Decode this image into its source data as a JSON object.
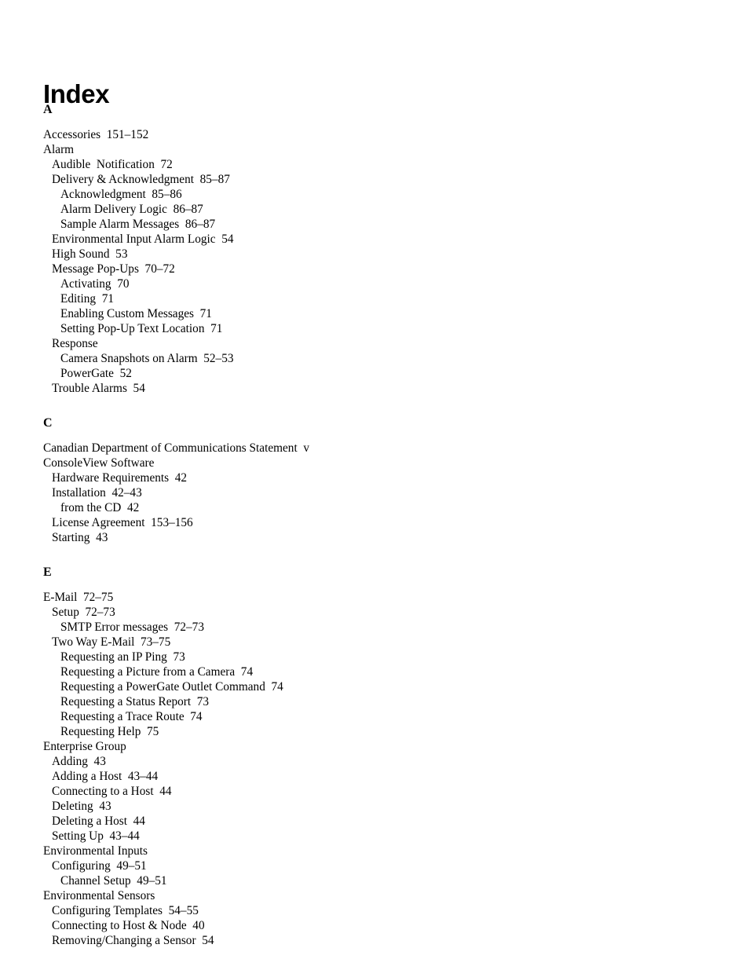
{
  "document": {
    "title": "Index"
  },
  "sections": [
    {
      "letter": "A",
      "entries": [
        {
          "level": 0,
          "text": "Accessories  151–152"
        },
        {
          "level": 0,
          "text": "Alarm"
        },
        {
          "level": 1,
          "text": "Audible  Notification  72"
        },
        {
          "level": 1,
          "text": "Delivery & Acknowledgment  85–87"
        },
        {
          "level": 2,
          "text": "Acknowledgment  85–86"
        },
        {
          "level": 2,
          "text": "Alarm Delivery Logic  86–87"
        },
        {
          "level": 2,
          "text": "Sample Alarm Messages  86–87"
        },
        {
          "level": 1,
          "text": "Environmental Input Alarm Logic  54"
        },
        {
          "level": 1,
          "text": "High Sound  53"
        },
        {
          "level": 1,
          "text": "Message Pop-Ups  70–72"
        },
        {
          "level": 2,
          "text": "Activating  70"
        },
        {
          "level": 2,
          "text": "Editing  71"
        },
        {
          "level": 2,
          "text": "Enabling Custom Messages  71"
        },
        {
          "level": 2,
          "text": "Setting Pop-Up Text Location  71"
        },
        {
          "level": 1,
          "text": "Response"
        },
        {
          "level": 2,
          "text": "Camera Snapshots on Alarm  52–53"
        },
        {
          "level": 2,
          "text": "PowerGate  52"
        },
        {
          "level": 1,
          "text": "Trouble Alarms  54"
        }
      ]
    },
    {
      "letter": "C",
      "entries": [
        {
          "level": 0,
          "text": "Canadian Department of Communications Statement  v"
        },
        {
          "level": 0,
          "text": "ConsoleView Software"
        },
        {
          "level": 1,
          "text": "Hardware Requirements  42"
        },
        {
          "level": 1,
          "text": "Installation  42–43"
        },
        {
          "level": 2,
          "text": "from the CD  42"
        },
        {
          "level": 1,
          "text": "License Agreement  153–156"
        },
        {
          "level": 1,
          "text": "Starting  43"
        }
      ]
    },
    {
      "letter": "E",
      "entries": [
        {
          "level": 0,
          "text": "E-Mail  72–75"
        },
        {
          "level": 1,
          "text": "Setup  72–73"
        },
        {
          "level": 2,
          "text": "SMTP Error messages  72–73"
        },
        {
          "level": 1,
          "text": "Two Way E-Mail  73–75"
        },
        {
          "level": 2,
          "text": "Requesting an IP Ping  73"
        },
        {
          "level": 2,
          "text": "Requesting a Picture from a Camera  74"
        },
        {
          "level": 2,
          "text": "Requesting a PowerGate Outlet Command  74"
        },
        {
          "level": 2,
          "text": "Requesting a Status Report  73"
        },
        {
          "level": 2,
          "text": "Requesting a Trace Route  74"
        },
        {
          "level": 2,
          "text": "Requesting Help  75"
        },
        {
          "level": 0,
          "text": "Enterprise Group"
        },
        {
          "level": 1,
          "text": "Adding  43"
        },
        {
          "level": 1,
          "text": "Adding a Host  43–44"
        },
        {
          "level": 1,
          "text": "Connecting to a Host  44"
        },
        {
          "level": 1,
          "text": "Deleting  43"
        },
        {
          "level": 1,
          "text": "Deleting a Host  44"
        },
        {
          "level": 1,
          "text": "Setting Up  43–44"
        },
        {
          "level": 0,
          "text": "Environmental Inputs"
        },
        {
          "level": 1,
          "text": "Configuring  49–51"
        },
        {
          "level": 2,
          "text": "Channel Setup  49–51"
        },
        {
          "level": 0,
          "text": "Environmental Sensors"
        },
        {
          "level": 1,
          "text": "Configuring Templates  54–55"
        },
        {
          "level": 1,
          "text": "Connecting to Host & Node  40"
        },
        {
          "level": 1,
          "text": "Removing/Changing a Sensor  54"
        }
      ]
    }
  ]
}
